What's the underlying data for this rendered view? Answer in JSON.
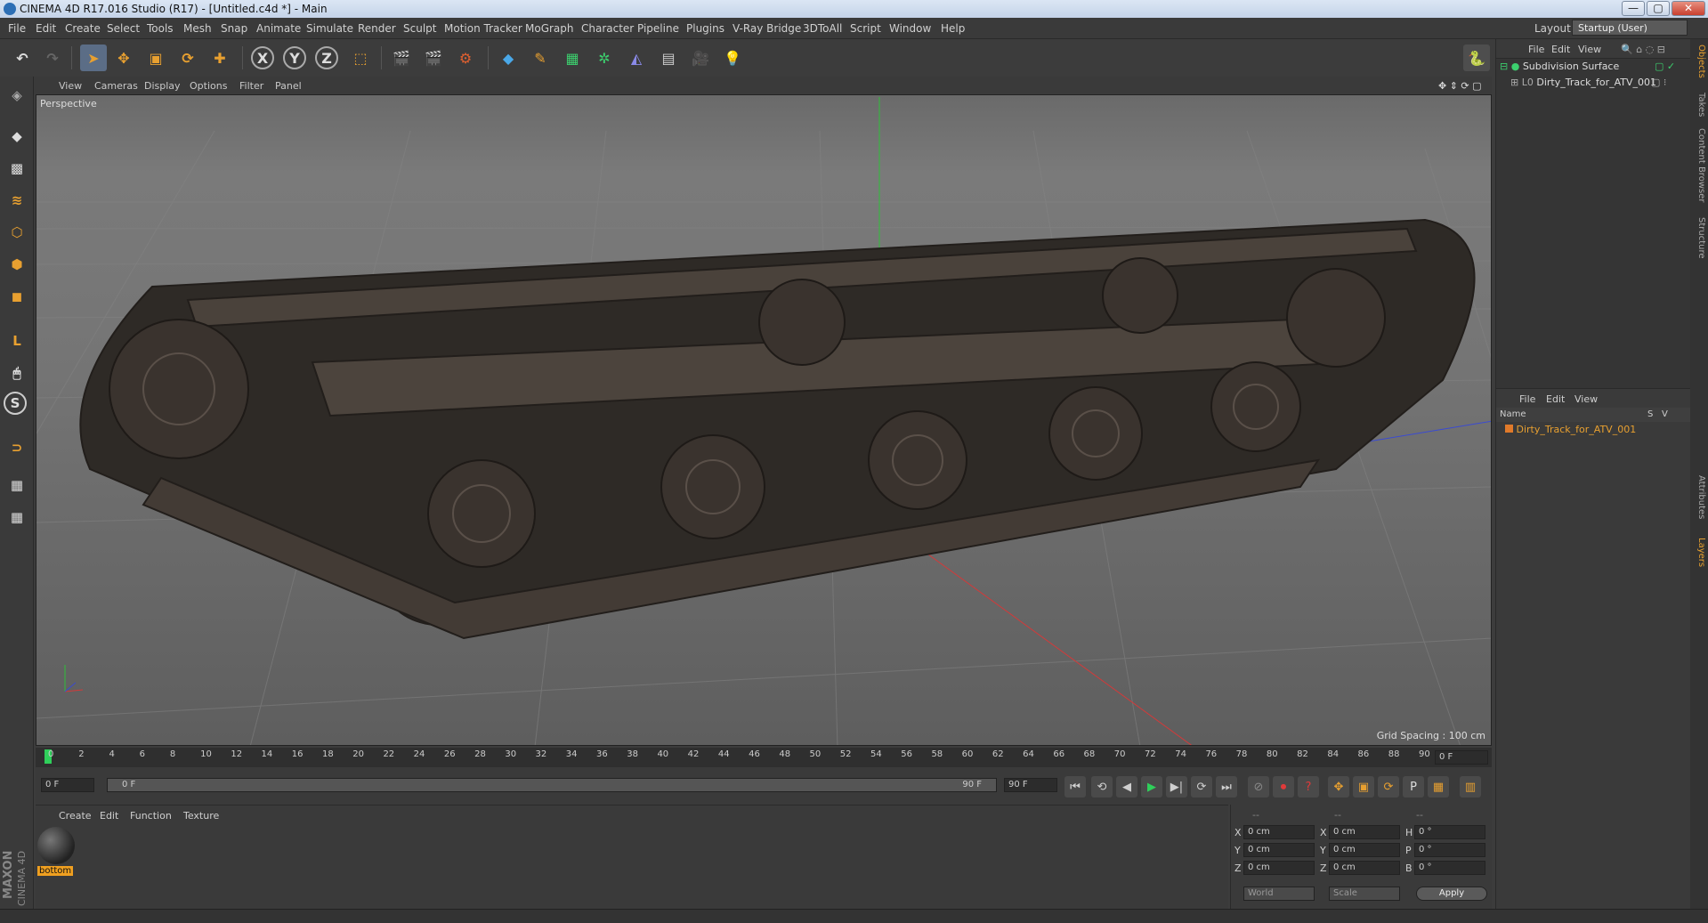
{
  "window": {
    "title": "CINEMA 4D R17.016 Studio (R17) - [Untitled.c4d *] - Main",
    "controls": [
      "—",
      "▢",
      "✕"
    ]
  },
  "menu": {
    "items": [
      "File",
      "Edit",
      "Create",
      "Select",
      "Tools",
      "Mesh",
      "Snap",
      "Animate",
      "Simulate",
      "Render",
      "Sculpt",
      "Motion Tracker",
      "MoGraph",
      "Character",
      "Pipeline",
      "Plugins",
      "V-Ray Bridge",
      "3DToAll",
      "Script",
      "Window",
      "Help"
    ],
    "layout_label": "Layout:",
    "layout_value": "Startup (User)"
  },
  "toolbar": {
    "axis_x": "X",
    "axis_y": "Y",
    "axis_z": "Z"
  },
  "viewport": {
    "menu": [
      "View",
      "Cameras",
      "Display",
      "Options",
      "Filter",
      "Panel"
    ],
    "label": "Perspective",
    "grid_spacing": "Grid Spacing : 100 cm"
  },
  "timeline": {
    "ticks": [
      "0",
      "2",
      "4",
      "6",
      "8",
      "10",
      "12",
      "14",
      "16",
      "18",
      "20",
      "22",
      "24",
      "26",
      "28",
      "30",
      "32",
      "34",
      "36",
      "38",
      "40",
      "42",
      "44",
      "46",
      "48",
      "50",
      "52",
      "54",
      "56",
      "58",
      "60",
      "62",
      "64",
      "66",
      "68",
      "70",
      "72",
      "74",
      "76",
      "78",
      "80",
      "82",
      "84",
      "86",
      "88",
      "90"
    ],
    "current_frame": "0 F",
    "start_frame": "0 F",
    "range_start": "0 F",
    "range_end": "90 F",
    "end_frame": "90 F"
  },
  "materials": {
    "menu": [
      "Create",
      "Edit",
      "Function",
      "Texture"
    ],
    "items": [
      {
        "name": "bottom"
      }
    ],
    "brand_top": "MAXON",
    "brand_bottom": "CINEMA 4D"
  },
  "coords": {
    "headers": [
      "--",
      "--",
      "--"
    ],
    "rows": [
      {
        "a": "X",
        "av": "0 cm",
        "b": "X",
        "bv": "0 cm",
        "c": "H",
        "cv": "0 °"
      },
      {
        "a": "Y",
        "av": "0 cm",
        "b": "Y",
        "bv": "0 cm",
        "c": "P",
        "cv": "0 °"
      },
      {
        "a": "Z",
        "av": "0 cm",
        "b": "Z",
        "bv": "0 cm",
        "c": "B",
        "cv": "0 °"
      }
    ],
    "mode1": "World",
    "mode2": "Scale",
    "apply": "Apply"
  },
  "objects": {
    "menu": [
      "File",
      "Edit",
      "View"
    ],
    "items": [
      {
        "name": "Subdivision Surface"
      },
      {
        "name": "Dirty_Track_for_ATV_001"
      }
    ]
  },
  "layers": {
    "menu": [
      "File",
      "Edit",
      "View"
    ],
    "col_name": "Name",
    "col_s": "S",
    "col_v": "V",
    "items": [
      {
        "name": "Dirty_Track_for_ATV_001",
        "color": "#e07a2a"
      }
    ]
  },
  "side_tabs": [
    "Objects",
    "Takes",
    "Content Browser",
    "Structure",
    "Attributes",
    "Layers"
  ]
}
